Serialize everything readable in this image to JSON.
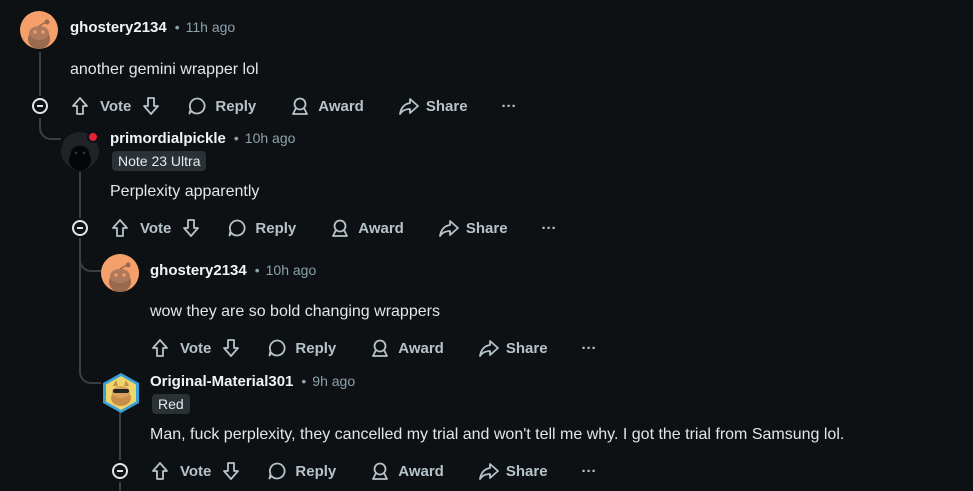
{
  "actions": {
    "vote": "Vote",
    "reply": "Reply",
    "award": "Award",
    "share": "Share",
    "more": "···"
  },
  "comments": [
    {
      "username": "ghostery2134",
      "time": "11h ago",
      "flair": "",
      "text": "another gemini wrapper lol",
      "avatar": "snoo-orange"
    },
    {
      "username": "primordialpickle",
      "time": "10h ago",
      "flair": "Note 23 Ultra",
      "text": "Perplexity apparently",
      "avatar": "snoo-dark-online"
    },
    {
      "username": "ghostery2134",
      "time": "10h ago",
      "flair": "",
      "text": "wow they are so bold changing wrappers",
      "avatar": "snoo-orange"
    },
    {
      "username": "Original-Material301",
      "time": "9h ago",
      "flair": "Red",
      "text": "Man, fuck perplexity, they cancelled my trial and won't tell me why. I got the trial from Samsung lol.",
      "avatar": "snoo-hexagon-cat"
    }
  ],
  "separator": "•",
  "colors": {
    "background": "#0e1113",
    "thread_line": "#3a3f42",
    "action_text": "#b7c3ca",
    "meta_text": "#8ba2ad",
    "avatar_orange": "#f5a06a",
    "online_dot": "#e0243b"
  }
}
